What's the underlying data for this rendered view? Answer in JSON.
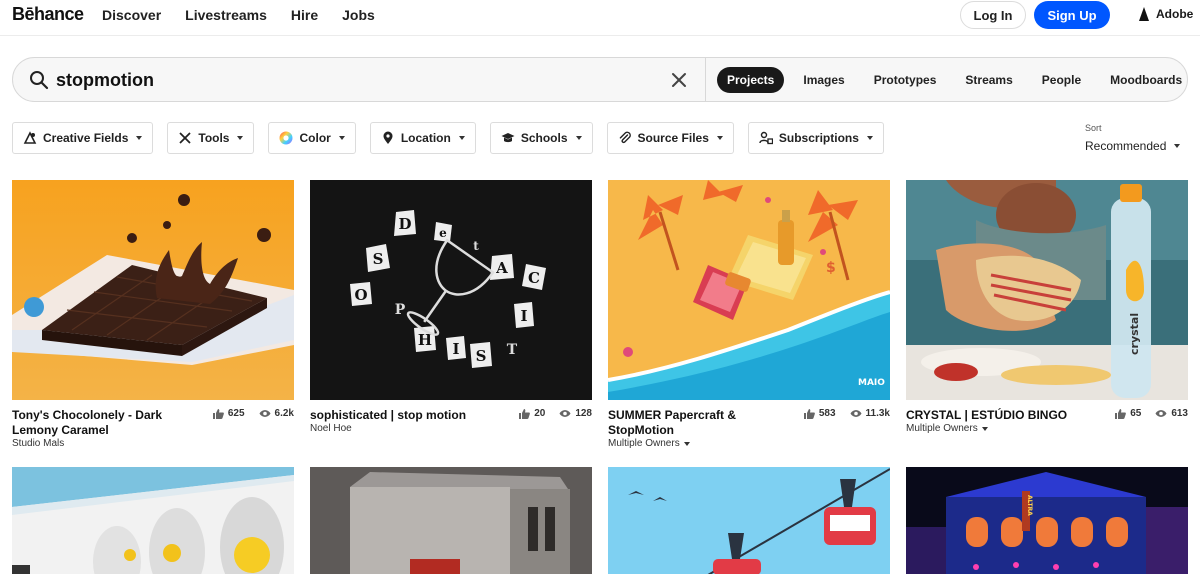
{
  "header": {
    "logo": "Bēhance",
    "nav": [
      "Discover",
      "Livestreams",
      "Hire",
      "Jobs"
    ],
    "login_label": "Log In",
    "signup_label": "Sign Up",
    "adobe_label": "Adobe"
  },
  "search": {
    "value": "stopmotion",
    "tabs": [
      {
        "label": "Projects",
        "active": true
      },
      {
        "label": "Images",
        "active": false
      },
      {
        "label": "Prototypes",
        "active": false
      },
      {
        "label": "Streams",
        "active": false
      },
      {
        "label": "People",
        "active": false
      },
      {
        "label": "Moodboards",
        "active": false
      }
    ]
  },
  "filters": [
    {
      "label": "Creative Fields",
      "icon": "creative-fields-icon"
    },
    {
      "label": "Tools",
      "icon": "tools-icon"
    },
    {
      "label": "Color",
      "icon": "color-wheel-icon"
    },
    {
      "label": "Location",
      "icon": "location-pin-icon"
    },
    {
      "label": "Schools",
      "icon": "graduation-cap-icon"
    },
    {
      "label": "Source Files",
      "icon": "paperclip-icon"
    },
    {
      "label": "Subscriptions",
      "icon": "subscriptions-icon"
    }
  ],
  "sort": {
    "label": "Sort",
    "value": "Recommended"
  },
  "projects": [
    {
      "title": "Tony's Chocolonely - Dark Lemony Caramel",
      "owner": "Studio Mals",
      "multiple_owners": false,
      "appreciations": "625",
      "views": "6.2k"
    },
    {
      "title": "sophisticated | stop motion",
      "owner": "Noel Hoe",
      "multiple_owners": false,
      "appreciations": "20",
      "views": "128"
    },
    {
      "title": "SUMMER Papercraft & StopMotion",
      "owner": "Multiple Owners",
      "multiple_owners": true,
      "appreciations": "583",
      "views": "11.3k"
    },
    {
      "title": "CRYSTAL | ESTÚDIO BINGO",
      "owner": "Multiple Owners",
      "multiple_owners": true,
      "appreciations": "65",
      "views": "613"
    }
  ],
  "thumb_text": {
    "letters": [
      "D",
      "e",
      "S",
      "t",
      "A",
      "C",
      "O",
      "P",
      "I",
      "H",
      "I",
      "S",
      "T"
    ],
    "watermark": "MAIO",
    "bottle_brand": "crystal",
    "building_sign": "ALTRA"
  },
  "colors": {
    "accent": "#0057ff",
    "active_tab": "#191919"
  }
}
